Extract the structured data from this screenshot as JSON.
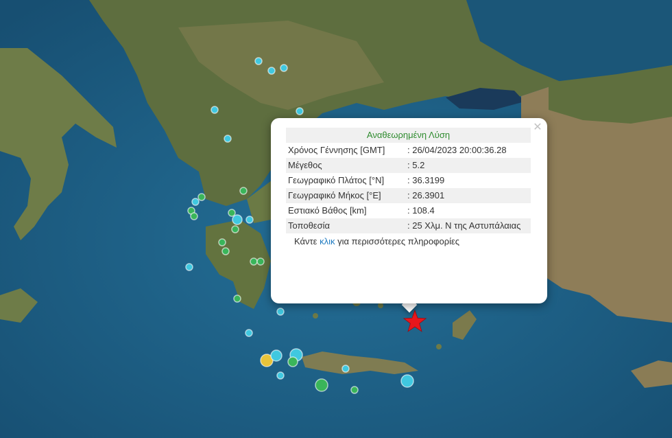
{
  "popup": {
    "title": "Αναθεωρημένη Λύση",
    "close_symbol": "✕",
    "rows": [
      {
        "label": "Χρόνος Γέννησης [GMT]",
        "value": ": 26/04/2023 20:00:36.28"
      },
      {
        "label": "Μέγεθος",
        "value": ": 5.2"
      },
      {
        "label": "Γεωγραφικό Πλάτος [°N]",
        "value": ": 36.3199"
      },
      {
        "label": "Γεωγραφικό Μήκος [°E]",
        "value": ": 26.3901"
      },
      {
        "label": "Εστιακό Βάθος [km]",
        "value": ": 108.4"
      },
      {
        "label": "Τοποθεσία",
        "value": ": 25 Χλμ. Ν της Αστυπάλαιας"
      }
    ],
    "footer_prefix": "Κάντε ",
    "footer_link": "κλικ",
    "footer_suffix": " για περισσότερες πληροφορίες"
  },
  "colors": {
    "sea_deep": "#1d5f86",
    "sea_shallow": "#2a7ca3",
    "land": "#6b7a4a",
    "land_dry": "#a08a66",
    "marker_cyan": "#40c8e0",
    "marker_green": "#3ab55a",
    "marker_yellow": "#e8c43a",
    "epicenter_star": "#e8161c"
  },
  "markers": {
    "epicenter": "star-icon",
    "events": "circle-icon"
  }
}
